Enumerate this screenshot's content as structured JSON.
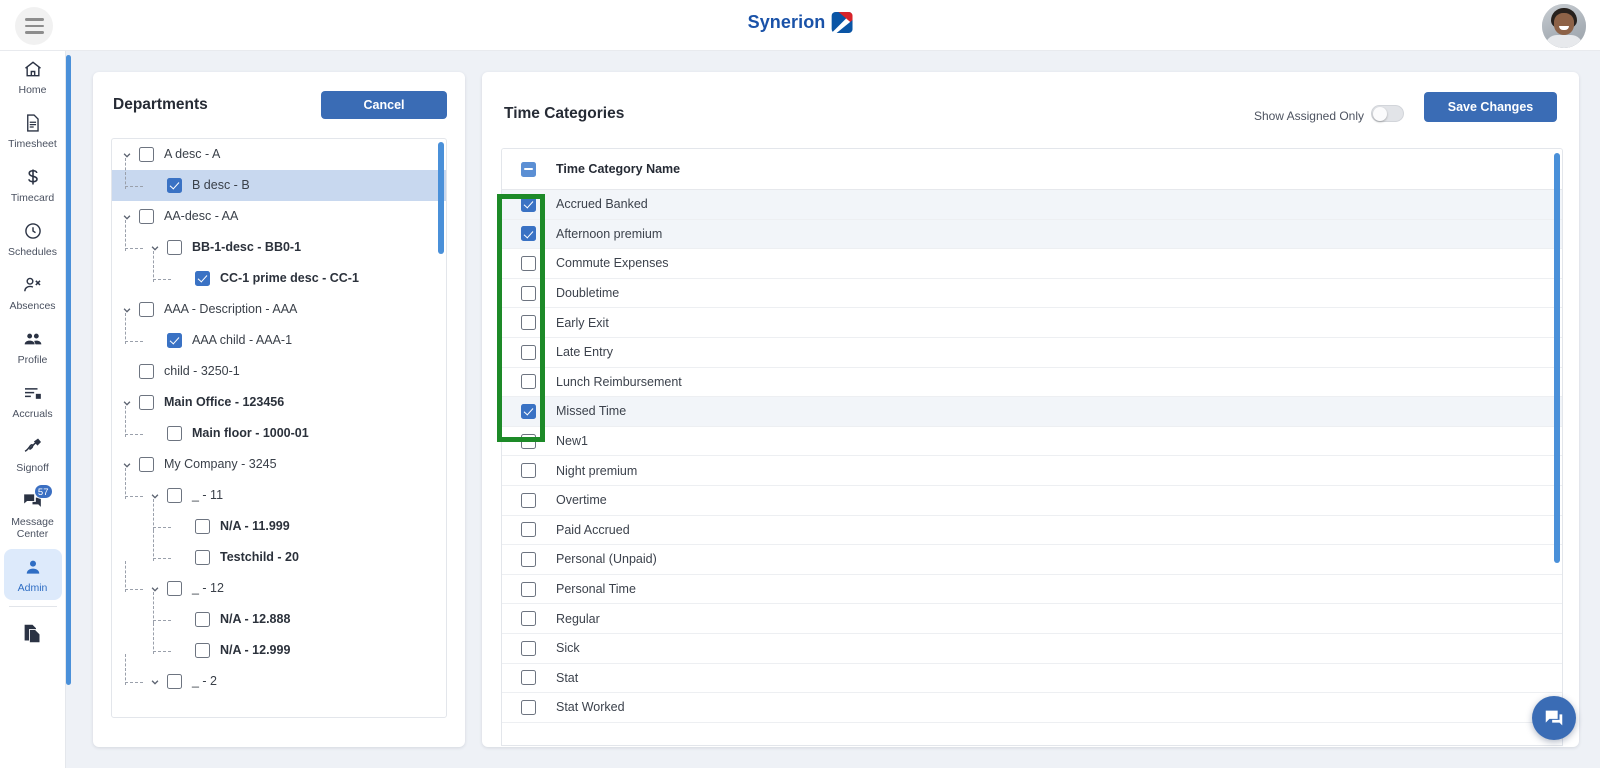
{
  "topbar": {
    "menu_icon": "hamburger-icon",
    "brand_name": "Synerion",
    "avatar_icon": "user-avatar"
  },
  "sidebar": {
    "items": [
      {
        "label": "Home",
        "icon": "home-icon",
        "active": false,
        "badge": ""
      },
      {
        "label": "Timesheet",
        "icon": "document-icon",
        "active": false,
        "badge": ""
      },
      {
        "label": "Timecard",
        "icon": "dollar-icon",
        "active": false,
        "badge": ""
      },
      {
        "label": "Schedules",
        "icon": "clock-icon",
        "active": false,
        "badge": ""
      },
      {
        "label": "Absences",
        "icon": "person-remove-icon",
        "active": false,
        "badge": ""
      },
      {
        "label": "Profile",
        "icon": "people-icon",
        "active": false,
        "badge": ""
      },
      {
        "label": "Accruals",
        "icon": "list-icon",
        "active": false,
        "badge": ""
      },
      {
        "label": "Signoff",
        "icon": "signature-icon",
        "active": false,
        "badge": ""
      },
      {
        "label": "Message Center",
        "icon": "chat-icon",
        "active": false,
        "badge": "57"
      },
      {
        "label": "Admin",
        "icon": "person-icon",
        "active": true,
        "badge": ""
      }
    ],
    "footer_icon": "copy-documents-icon"
  },
  "departments": {
    "title": "Departments",
    "cancel_label": "Cancel",
    "tree": [
      {
        "label": "A desc - A",
        "depth": 0,
        "checked": false,
        "expanded": true,
        "bold": false,
        "selected": false
      },
      {
        "label": "B desc - B",
        "depth": 1,
        "checked": true,
        "expanded": null,
        "bold": false,
        "selected": true
      },
      {
        "label": "AA-desc - AA",
        "depth": 0,
        "checked": false,
        "expanded": true,
        "bold": false,
        "selected": false
      },
      {
        "label": "BB-1-desc - BB0-1",
        "depth": 1,
        "checked": false,
        "expanded": true,
        "bold": true,
        "selected": false
      },
      {
        "label": "CC-1 prime desc - CC-1",
        "depth": 2,
        "checked": true,
        "expanded": null,
        "bold": true,
        "selected": false
      },
      {
        "label": "AAA - Description - AAA",
        "depth": 0,
        "checked": false,
        "expanded": true,
        "bold": false,
        "selected": false
      },
      {
        "label": "AAA child - AAA-1",
        "depth": 1,
        "checked": true,
        "expanded": null,
        "bold": false,
        "selected": false
      },
      {
        "label": "child - 3250-1",
        "depth": 0,
        "checked": false,
        "expanded": null,
        "bold": false,
        "selected": false
      },
      {
        "label": "Main Office - 123456",
        "depth": 0,
        "checked": false,
        "expanded": true,
        "bold": true,
        "selected": false
      },
      {
        "label": "Main floor - 1000-01",
        "depth": 1,
        "checked": false,
        "expanded": null,
        "bold": true,
        "selected": false
      },
      {
        "label": "My Company - 3245",
        "depth": 0,
        "checked": false,
        "expanded": true,
        "bold": false,
        "selected": false
      },
      {
        "label": "_ - 11",
        "depth": 1,
        "checked": false,
        "expanded": true,
        "bold": false,
        "selected": false
      },
      {
        "label": "N/A - 11.999",
        "depth": 2,
        "checked": false,
        "expanded": null,
        "bold": true,
        "selected": false
      },
      {
        "label": "Testchild - 20",
        "depth": 2,
        "checked": false,
        "expanded": null,
        "bold": true,
        "selected": false
      },
      {
        "label": "_ - 12",
        "depth": 1,
        "checked": false,
        "expanded": true,
        "bold": false,
        "selected": false
      },
      {
        "label": "N/A - 12.888",
        "depth": 2,
        "checked": false,
        "expanded": null,
        "bold": true,
        "selected": false
      },
      {
        "label": "N/A - 12.999",
        "depth": 2,
        "checked": false,
        "expanded": null,
        "bold": true,
        "selected": false
      },
      {
        "label": "_ - 2",
        "depth": 1,
        "checked": false,
        "expanded": true,
        "bold": false,
        "selected": false
      }
    ]
  },
  "time_categories": {
    "title": "Time Categories",
    "toggle_label": "Show Assigned Only",
    "toggle_on": false,
    "save_label": "Save Changes",
    "column_header": "Time Category Name",
    "header_checkbox_state": "indeterminate",
    "rows": [
      {
        "name": "Accrued Banked",
        "checked": true
      },
      {
        "name": "Afternoon premium",
        "checked": true
      },
      {
        "name": "Commute Expenses",
        "checked": false
      },
      {
        "name": "Doubletime",
        "checked": false
      },
      {
        "name": "Early Exit",
        "checked": false
      },
      {
        "name": "Late Entry",
        "checked": false
      },
      {
        "name": "Lunch Reimbursement",
        "checked": false
      },
      {
        "name": "Missed Time",
        "checked": true
      },
      {
        "name": "New1",
        "checked": false
      },
      {
        "name": "Night premium",
        "checked": false
      },
      {
        "name": "Overtime",
        "checked": false
      },
      {
        "name": "Paid Accrued",
        "checked": false
      },
      {
        "name": "Personal (Unpaid)",
        "checked": false
      },
      {
        "name": "Personal Time",
        "checked": false
      },
      {
        "name": "Regular",
        "checked": false
      },
      {
        "name": "Sick",
        "checked": false
      },
      {
        "name": "Stat",
        "checked": false
      },
      {
        "name": "Stat Worked",
        "checked": false
      }
    ]
  },
  "annotations": {
    "highlight_box_color": "#1d8a28",
    "highlight_target": "time-category-checkbox-column"
  },
  "fab": {
    "icon": "chat-bubbles-icon"
  },
  "colors": {
    "accent_blue": "#3a6cb5",
    "checkbox_blue": "#3a72c4",
    "scrollbar_blue": "#4a90d9",
    "selected_row": "#c8d8ef",
    "alt_row": "#f2f5f9",
    "page_bg": "#eef1f6",
    "brand_blue": "#1a52a8",
    "brand_red": "#d8232a"
  }
}
